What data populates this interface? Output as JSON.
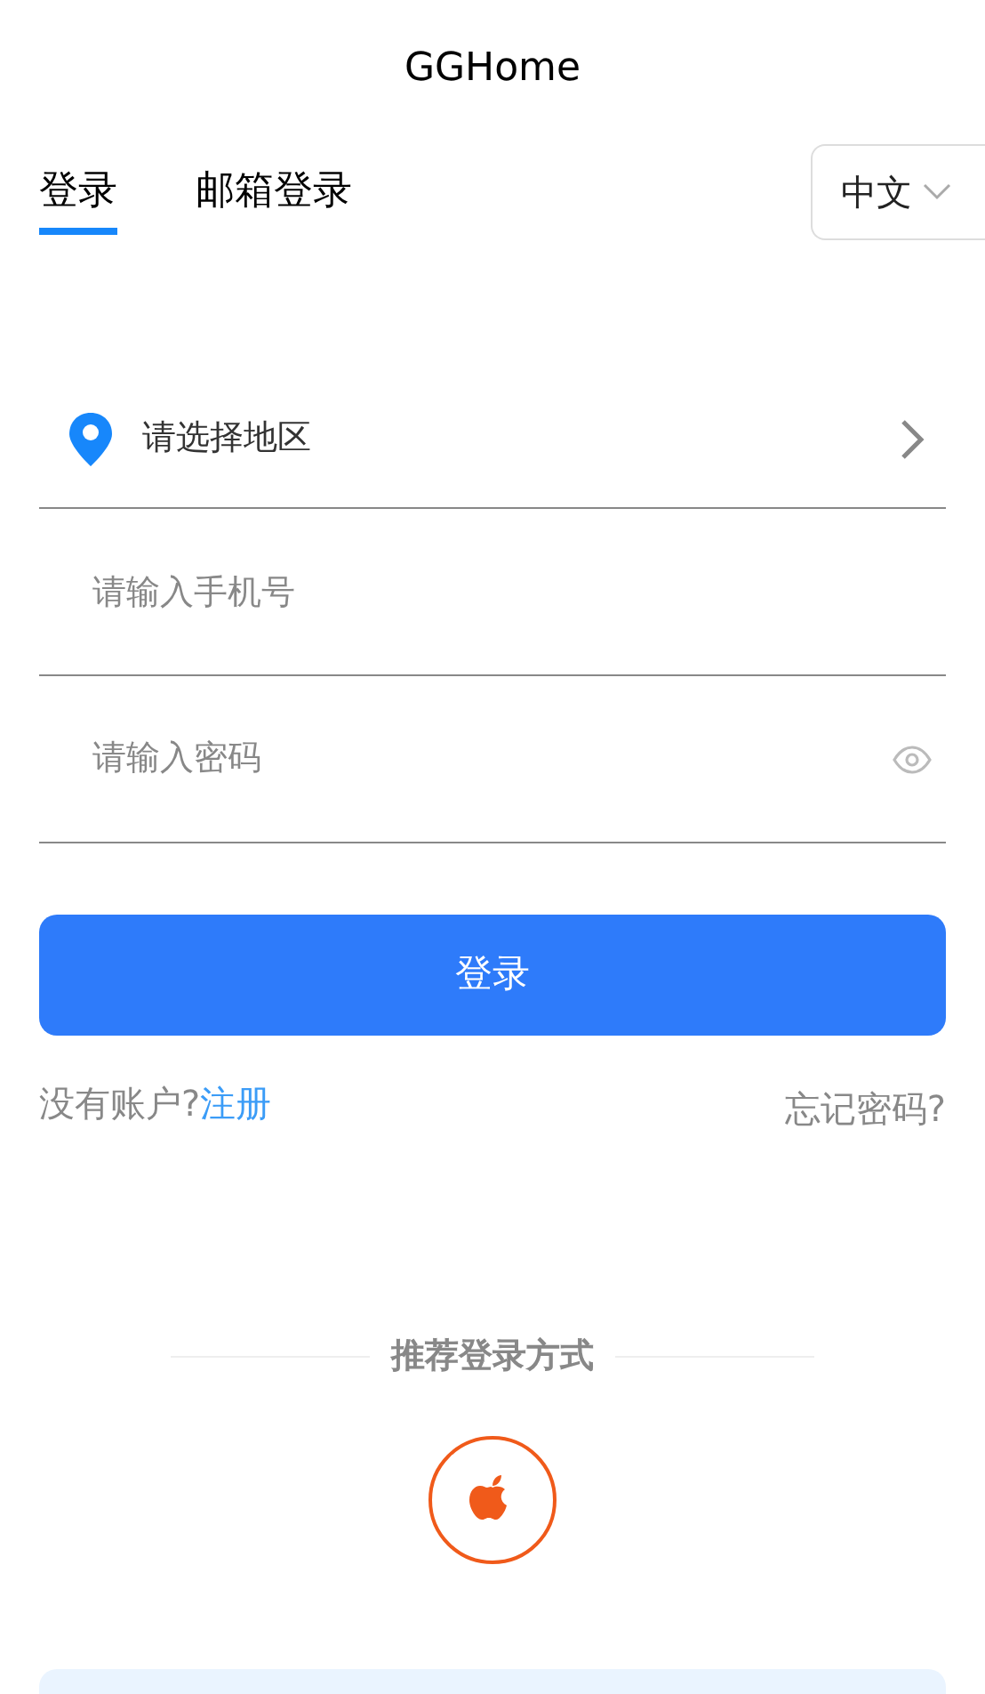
{
  "title": "GGHome",
  "tabs": [
    {
      "label": "登录",
      "selected": true
    },
    {
      "label": "邮箱登录",
      "selected": false
    }
  ],
  "language": "中文",
  "region": {
    "placeholder": "请选择地区"
  },
  "phone": {
    "placeholder": "请输入手机号"
  },
  "password": {
    "placeholder": "请输入密码"
  },
  "login_button": "登录",
  "register_prompt": "没有账户?",
  "register_link": "注册",
  "forgot_password": "忘记密码?",
  "alt_login_title": "推荐登录方式"
}
